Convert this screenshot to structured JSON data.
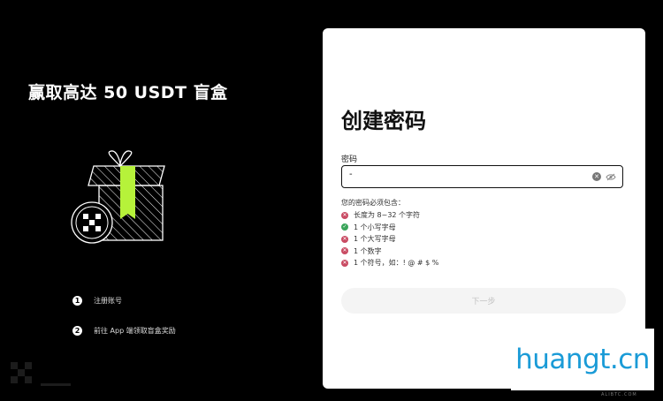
{
  "promo": {
    "title": "赢取高达 50 USDT 盲盒",
    "steps": [
      {
        "num": "1",
        "label": "注册账号"
      },
      {
        "num": "2",
        "label": "前往 App 端领取盲盒奖励"
      }
    ]
  },
  "card": {
    "title": "创建密码",
    "password_label": "密码",
    "password_value": "-",
    "requirements_title": "您的密码必须包含：",
    "requirements": [
      {
        "text": "长度为 8~32 个字符",
        "status": "fail"
      },
      {
        "text": "1 个小写字母",
        "status": "pass"
      },
      {
        "text": "1 个大写字母",
        "status": "fail"
      },
      {
        "text": "1 个数字",
        "status": "fail"
      },
      {
        "text": "1 个符号，如：! @ # $ %",
        "status": "fail"
      }
    ],
    "next_label": "下一步"
  },
  "colors": {
    "pass": "#3aa55a",
    "fail": "#c94b63",
    "accent": "#b6f23a",
    "watermark": "#1a9bd7"
  },
  "watermark": {
    "text": "huangt.cn",
    "sub": "ALIBTC.COM"
  }
}
